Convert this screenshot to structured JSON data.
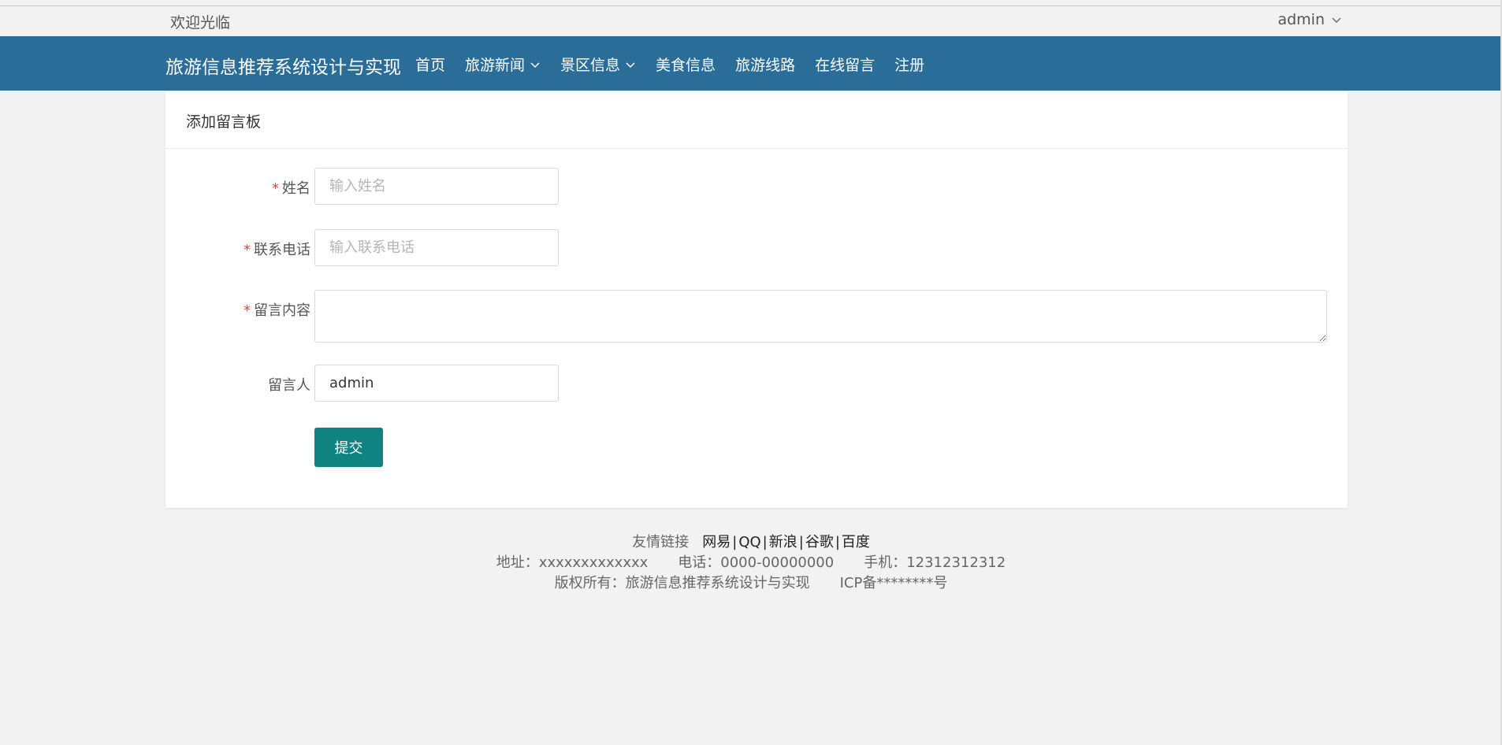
{
  "topbar": {
    "welcome": "欢迎光临",
    "user": "admin"
  },
  "navbar": {
    "brand": "旅游信息推荐系统设计与实现",
    "items": [
      {
        "label": "首页",
        "dropdown": false
      },
      {
        "label": "旅游新闻",
        "dropdown": true
      },
      {
        "label": "景区信息",
        "dropdown": true
      },
      {
        "label": "美食信息",
        "dropdown": false
      },
      {
        "label": "旅游线路",
        "dropdown": false
      },
      {
        "label": "在线留言",
        "dropdown": false
      },
      {
        "label": "注册",
        "dropdown": false
      }
    ]
  },
  "form": {
    "title": "添加留言板",
    "fields": {
      "name": {
        "label": "姓名",
        "required": "*",
        "placeholder": "输入姓名",
        "value": ""
      },
      "phone": {
        "label": "联系电话",
        "required": "*",
        "placeholder": "输入联系电话",
        "value": ""
      },
      "content": {
        "label": "留言内容",
        "required": "*",
        "value": ""
      },
      "author": {
        "label": "留言人",
        "value": "admin"
      }
    },
    "submit_label": "提交"
  },
  "footer": {
    "links_label": "友情链接",
    "links": [
      "网易",
      "QQ",
      "新浪",
      "谷歌",
      "百度"
    ],
    "address": "地址：xxxxxxxxxxxxx",
    "phone": "电话：0000-00000000",
    "mobile": "手机：12312312312",
    "copyright": "版权所有：旅游信息推荐系统设计与实现",
    "icp": "ICP备********号"
  },
  "colors": {
    "navbar_bg": "#2b6d99",
    "button_bg": "#0f8282",
    "required": "#e04646",
    "page_bg": "#f2f2f2"
  }
}
